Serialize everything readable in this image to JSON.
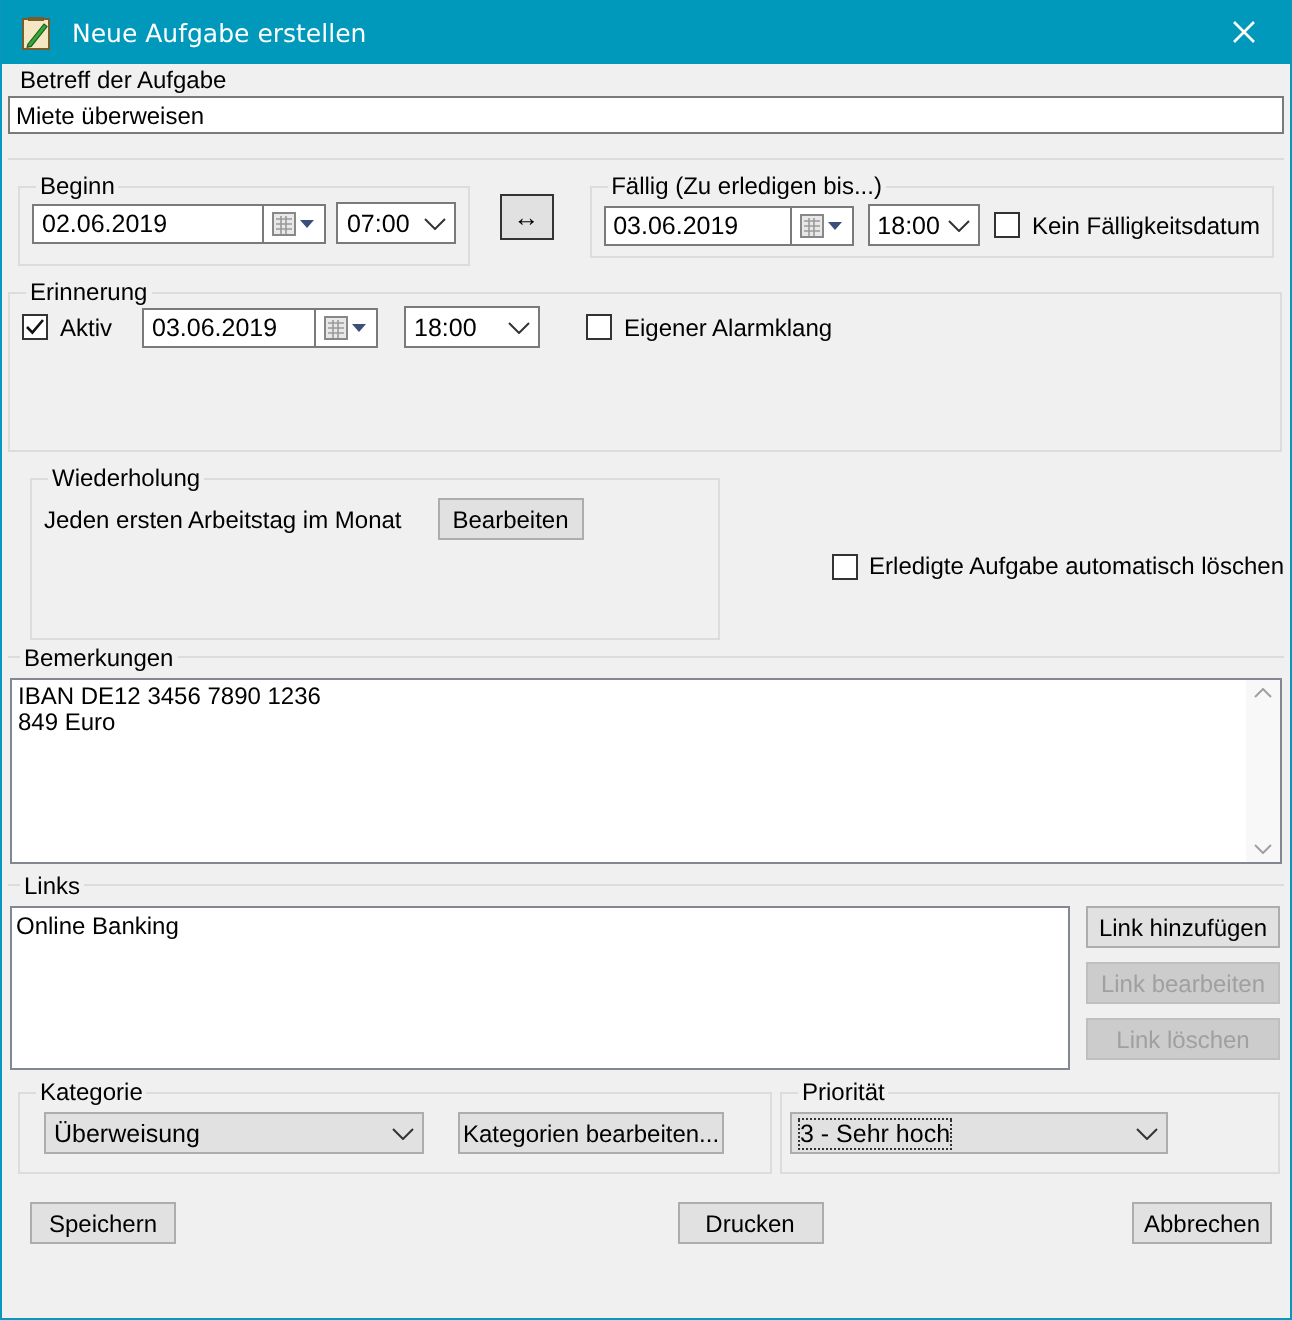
{
  "window": {
    "title": "Neue Aufgabe erstellen"
  },
  "subject": {
    "label": "Betreff der Aufgabe",
    "value": "Miete überweisen"
  },
  "start": {
    "label": "Beginn",
    "date": "02.06.2019",
    "time": "07:00"
  },
  "swap_button": "↔",
  "due": {
    "label": "Fällig (Zu erledigen bis...)",
    "date": "03.06.2019",
    "time": "18:00",
    "no_due_date": {
      "label": "Kein Fälligkeitsdatum",
      "checked": false
    }
  },
  "reminder": {
    "label": "Erinnerung",
    "active": {
      "label": "Aktiv",
      "checked": true
    },
    "date": "03.06.2019",
    "time": "18:00",
    "custom_sound": {
      "label": "Eigener Alarmklang",
      "checked": false
    }
  },
  "recurrence": {
    "label": "Wiederholung",
    "text": "Jeden ersten Arbeitstag im Monat",
    "button": "Bearbeiten"
  },
  "auto_delete": {
    "label": "Erledigte Aufgabe automatisch löschen",
    "checked": false
  },
  "notes": {
    "label": "Bemerkungen",
    "lines": [
      "IBAN DE12 3456 7890 1236",
      "849 Euro"
    ]
  },
  "links": {
    "label": "Links",
    "items": [
      "Online Banking"
    ],
    "buttons": [
      {
        "label": "Link hinzufügen",
        "disabled": false
      },
      {
        "label": "Link bearbeiten",
        "disabled": true
      },
      {
        "label": "Link löschen",
        "disabled": true
      }
    ]
  },
  "category": {
    "label": "Kategorie",
    "value": "Überweisung",
    "button": "Kategorien bearbeiten..."
  },
  "priority": {
    "label": "Priorität",
    "value": "3 - Sehr hoch"
  },
  "footer_buttons": [
    "Speichern",
    "Drucken",
    "Abbrechen"
  ]
}
